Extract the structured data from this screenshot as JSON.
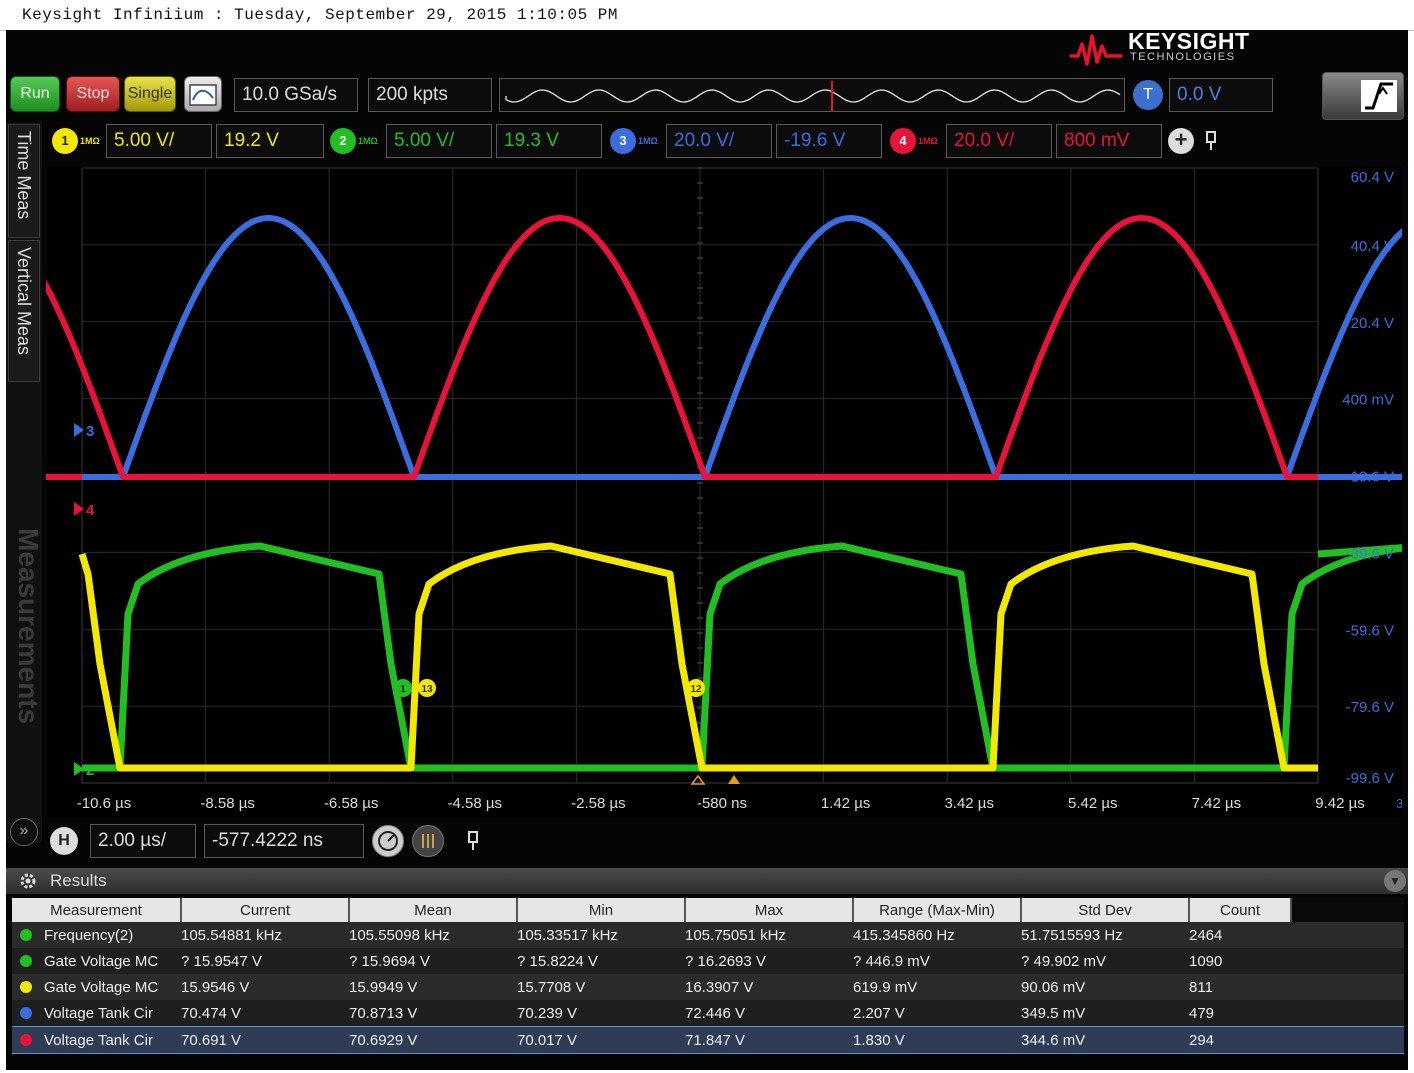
{
  "window_title": "Keysight Infiniium : Tuesday, September 29, 2015 1:10:05 PM",
  "brand": {
    "name": "KEYSIGHT",
    "sub": "TECHNOLOGIES"
  },
  "colors": {
    "ch1": "#f2e800",
    "ch2": "#22bf22",
    "ch3": "#3a6de0",
    "ch4": "#e8123a",
    "background": "#000000",
    "grid": "#2c2c2c"
  },
  "toolbar": {
    "run_label": "Run",
    "stop_label": "Stop",
    "single_label": "Single",
    "sample_rate": "10.0 GSa/s",
    "memory_depth": "200 kpts",
    "trigger_badge": "T",
    "trigger_level": "0.0 V"
  },
  "channels": [
    {
      "num": "1",
      "impedance": "1MΩ",
      "scale": "5.00 V/",
      "offset": "19.2 V"
    },
    {
      "num": "2",
      "impedance": "1MΩ",
      "scale": "5.00 V/",
      "offset": "19.3 V"
    },
    {
      "num": "3",
      "impedance": "1MΩ",
      "scale": "20.0 V/",
      "offset": "-19.6 V"
    },
    {
      "num": "4",
      "impedance": "1MΩ",
      "scale": "20.0 V/",
      "offset": "800 mV"
    }
  ],
  "side_tabs": [
    "Time Meas",
    "Vertical Meas",
    "Measurements"
  ],
  "plot": {
    "y_labels": [
      "60.4 V",
      "40.4 V",
      "20.4 V",
      "400 mV",
      "-19.6 V",
      "-39.6 V",
      "-59.6 V",
      "-79.6 V",
      "-99.6 V"
    ],
    "x_labels": [
      "-10.6 µs",
      "-8.58 µs",
      "-6.58 µs",
      "-4.58 µs",
      "-2.58 µs",
      "-580 ns",
      "1.42 µs",
      "3.42 µs",
      "5.42 µs",
      "7.42 µs",
      "9.42 µs"
    ],
    "x_corner": "3",
    "markers": {
      "ch3": "3",
      "ch4": "4",
      "ch2": "2"
    },
    "meas_markers": [
      "1",
      "13",
      "12"
    ]
  },
  "horizontal": {
    "badge": "H",
    "scale": "2.00 µs/",
    "position": "-577.4222 ns"
  },
  "results": {
    "title": "Results",
    "columns": [
      "Measurement",
      "Current",
      "Mean",
      "Min",
      "Max",
      "Range (Max-Min)",
      "Std Dev",
      "Count"
    ],
    "rows": [
      {
        "color": "#22bf22",
        "name": "Frequency(2)",
        "current": "105.54881 kHz",
        "mean": "105.55098 kHz",
        "min": "105.33517 kHz",
        "max": "105.75051 kHz",
        "range": "415.345860 Hz",
        "std": "51.7515593 Hz",
        "count": "2464"
      },
      {
        "color": "#22bf22",
        "name": "Gate Voltage MC",
        "current": "? 15.9547 V",
        "mean": "? 15.9694 V",
        "min": "? 15.8224 V",
        "max": "? 16.2693 V",
        "range": "? 446.9 mV",
        "std": "? 49.902 mV",
        "count": "1090"
      },
      {
        "color": "#f2e800",
        "name": "Gate Voltage MC",
        "current": "15.9546 V",
        "mean": "15.9949 V",
        "min": "15.7708 V",
        "max": "16.3907 V",
        "range": "619.9 mV",
        "std": "90.06 mV",
        "count": "811"
      },
      {
        "color": "#3a6de0",
        "name": "Voltage Tank Cir",
        "current": "70.474 V",
        "mean": "70.8713 V",
        "min": "70.239 V",
        "max": "72.446 V",
        "range": "2.207 V",
        "std": "349.5 mV",
        "count": "479"
      },
      {
        "color": "#e8123a",
        "name": "Voltage Tank Cir",
        "current": "70.691 V",
        "mean": "70.6929 V",
        "min": "70.017 V",
        "max": "71.847 V",
        "range": "1.830 V",
        "std": "344.6 mV",
        "count": "294"
      }
    ]
  }
}
